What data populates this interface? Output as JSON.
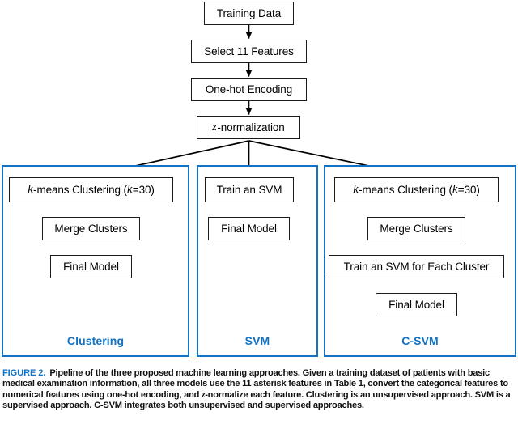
{
  "figure": {
    "label": "FIGURE 2.",
    "caption": "Pipeline of the three proposed machine learning approaches. Given a training dataset of patients with basic medical examination information, all three models use the 11 asterisk features in Table 1, convert the categorical features to numerical features using one-hot encoding, and ",
    "caption_italic_z": "z",
    "caption_tail": "-normalize each feature. Clustering is an unsupervised approach. SVM is a supervised approach. C-SVM integrates both unsupervised and supervised approaches."
  },
  "colors": {
    "accent_blue": "#1272c4",
    "node_border": "#1b1b1b",
    "background": "#ffffff",
    "connector": "#000000"
  },
  "pipeline": {
    "shared_nodes": [
      {
        "id": "training-data",
        "label": "Training Data"
      },
      {
        "id": "select-features",
        "label": "Select 11 Features"
      },
      {
        "id": "one-hot-encoding",
        "label": "One-hot Encoding"
      },
      {
        "id": "z-normalization",
        "italic_prefix": "z",
        "label": "-normalization"
      }
    ]
  },
  "approaches": [
    {
      "id": "clustering",
      "title": "Clustering",
      "nodes": [
        {
          "id": "clustering-kmeans",
          "italic_prefix": "k",
          "label_mid": "-means Clustering (",
          "italic_mid": "k",
          "label_tail": "=30)"
        },
        {
          "id": "clustering-merge",
          "label": "Merge Clusters"
        },
        {
          "id": "clustering-final",
          "label": "Final Model"
        }
      ]
    },
    {
      "id": "svm",
      "title": "SVM",
      "nodes": [
        {
          "id": "svm-train",
          "label": "Train an SVM"
        },
        {
          "id": "svm-final",
          "label": "Final Model"
        }
      ]
    },
    {
      "id": "c-svm",
      "title": "C-SVM",
      "nodes": [
        {
          "id": "csvm-kmeans",
          "italic_prefix": "k",
          "label_mid": "-means Clustering (",
          "italic_mid": "k",
          "label_tail": "=30)"
        },
        {
          "id": "csvm-merge",
          "label": "Merge Clusters"
        },
        {
          "id": "csvm-train",
          "label": "Train an SVM for Each Cluster"
        },
        {
          "id": "csvm-final",
          "label": "Final Model"
        }
      ]
    }
  ]
}
